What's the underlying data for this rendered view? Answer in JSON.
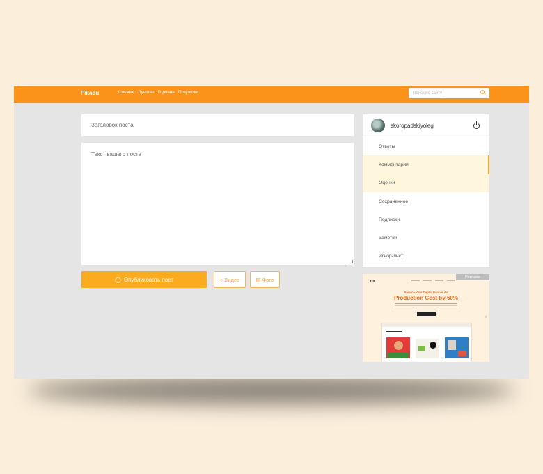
{
  "header": {
    "logo": "Pikadu",
    "nav": [
      "Свежее",
      "Лучшее",
      "Горячее",
      "Подписки"
    ],
    "search_placeholder": "Поиск по сайту"
  },
  "editor": {
    "title_placeholder": "Заголовок поста",
    "text_placeholder": "Текст вашего поста",
    "publish_label": "Опубликовать пост",
    "video_label": "Видео",
    "photo_label": "Фото"
  },
  "sidebar": {
    "username": "skoropadskiyoleg",
    "items": [
      {
        "label": "Ответы",
        "active": false
      },
      {
        "label": "Комментарии",
        "active": true
      },
      {
        "label": "Оценки",
        "active": true
      },
      {
        "label": "Сохраненное",
        "active": false
      },
      {
        "label": "Подписки",
        "active": false
      },
      {
        "label": "Заметки",
        "active": false
      },
      {
        "label": "Игнор-лист",
        "active": false
      }
    ]
  },
  "ad": {
    "badge": "Реклама",
    "kicker": "Reduce Your Digital Banner Ad",
    "headline": "Production Cost by 60%"
  },
  "colors": {
    "accent": "#fb931b",
    "button": "#fbab1f",
    "active_bg": "#fef6dd",
    "page_bg": "#fbeedb",
    "window_bg": "#e5e5e5"
  }
}
